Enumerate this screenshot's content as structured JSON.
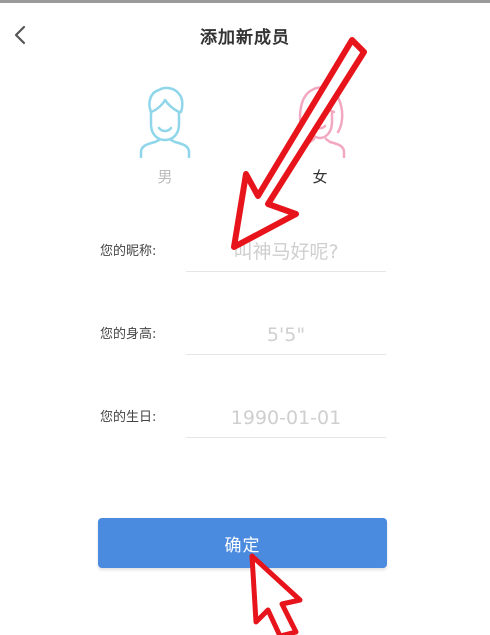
{
  "header": {
    "title": "添加新成员"
  },
  "gender": {
    "male_label": "男",
    "female_label": "女",
    "selected": "female"
  },
  "form": {
    "nickname": {
      "label": "您的昵称:",
      "placeholder": "叫神马好呢?"
    },
    "height": {
      "label": "您的身高:",
      "placeholder": "5'5\""
    },
    "birthday": {
      "label": "您的生日:",
      "placeholder": "1990-01-01"
    }
  },
  "confirm_label": "确定",
  "colors": {
    "accent": "#4a8be0",
    "male_avatar": "#8fd6ea",
    "female_avatar": "#f2a9c0",
    "annotation": "#e8141c"
  },
  "icons": {
    "back": "chevron-left-icon",
    "male": "male-avatar-icon",
    "female": "female-avatar-icon"
  }
}
